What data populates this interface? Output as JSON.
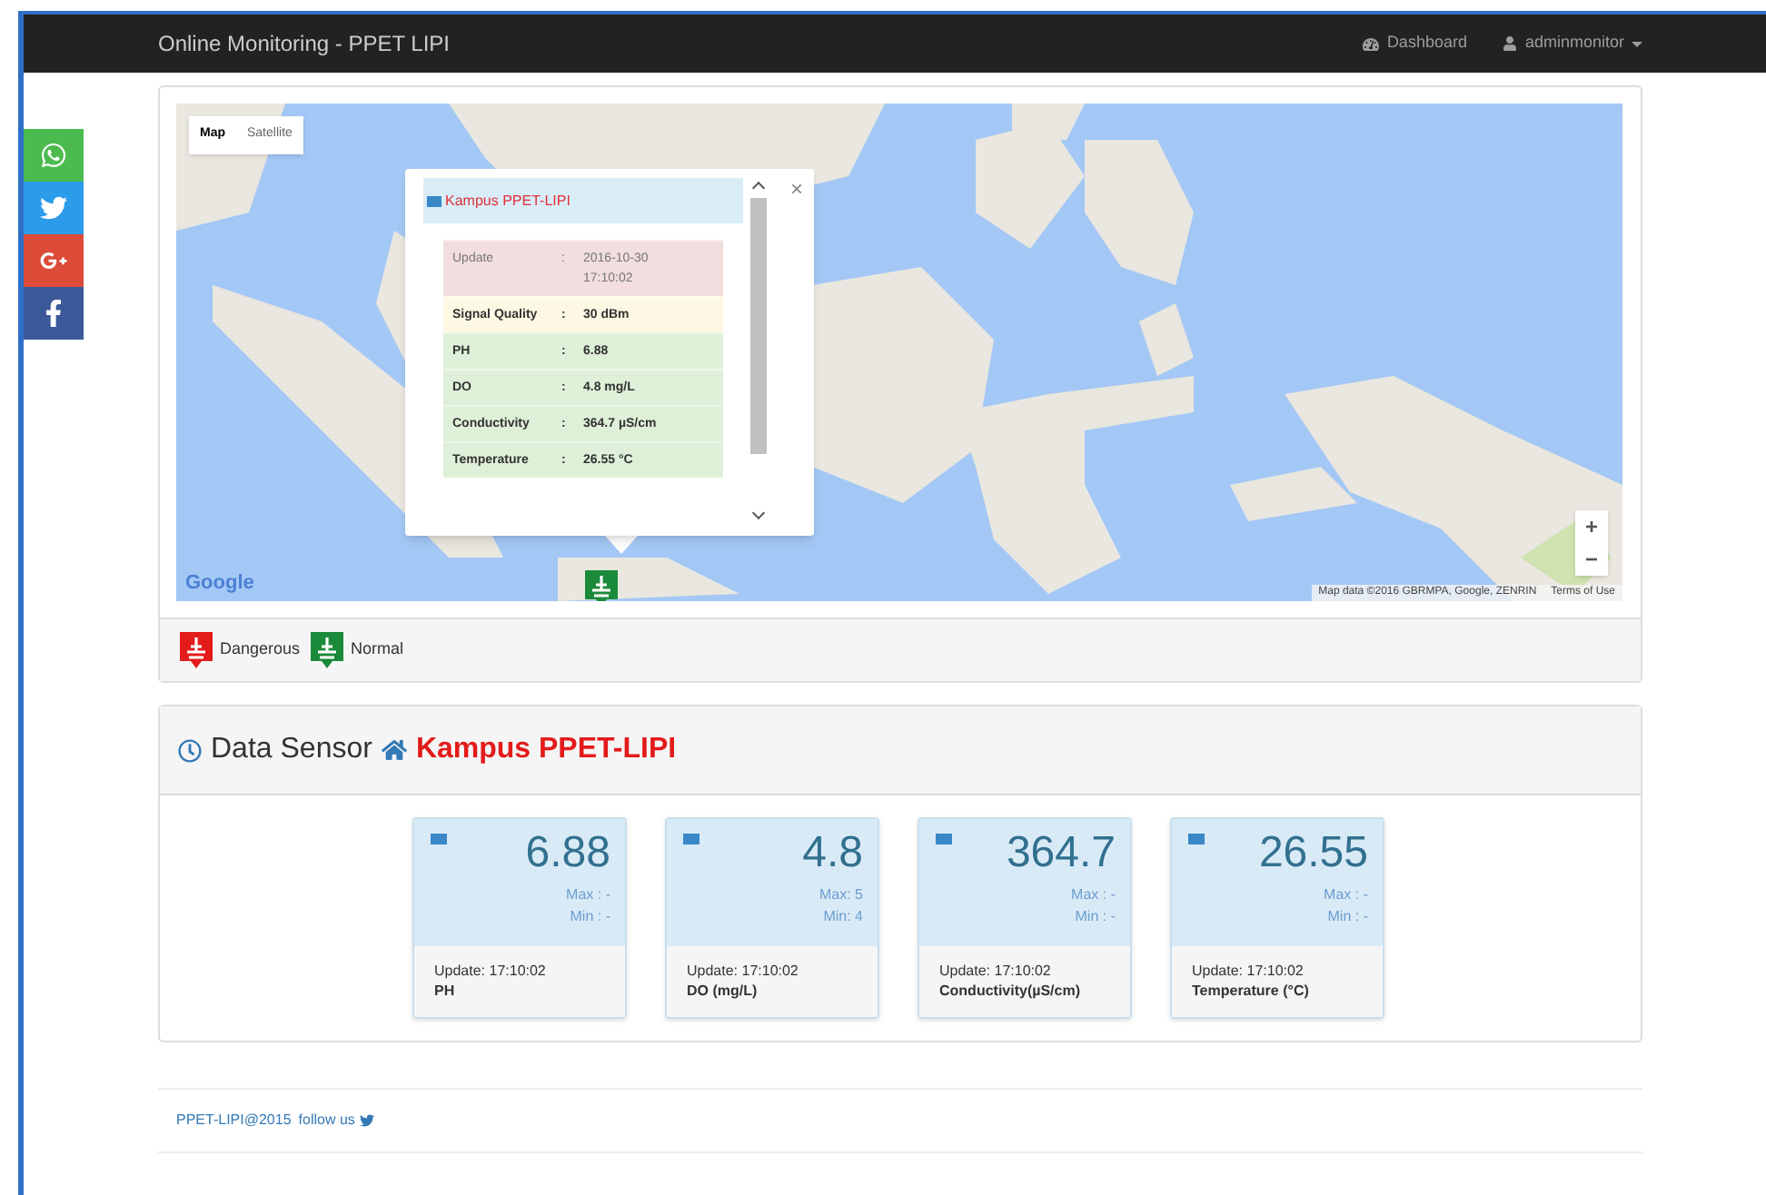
{
  "navbar": {
    "brand": "Online Monitoring - PPET LIPI",
    "links": [
      {
        "kind": "dashboard",
        "label": "Dashboard"
      },
      {
        "kind": "user",
        "label": "adminmonitor"
      }
    ]
  },
  "social": [
    {
      "kind": "whatsapp",
      "color": "#4cbb4f"
    },
    {
      "kind": "twitter",
      "color": "#2b9bea"
    },
    {
      "kind": "googleplus",
      "color": "#dd4b39"
    },
    {
      "kind": "facebook",
      "color": "#3b5998"
    }
  ],
  "map": {
    "types": [
      {
        "label": "Map",
        "selected": true
      },
      {
        "label": "Satellite",
        "selected": false
      }
    ],
    "logo": "Google",
    "attribution": "Map data ©2016 GBRMPA, Google, ZENRIN",
    "terms": "Terms of Use",
    "zoom_in": "+",
    "zoom_out": "−",
    "popup": {
      "title": "Kampus PPET-LIPI",
      "close": "×",
      "rows": [
        {
          "label": "Update",
          "sep": ":",
          "value": "2016-10-30 17:10:02",
          "kind": "danger"
        },
        {
          "label": "Signal Quality",
          "sep": ":",
          "value": "30 dBm",
          "kind": "warning"
        },
        {
          "label": "PH",
          "sep": ":",
          "value": "6.88",
          "kind": "success"
        },
        {
          "label": "DO",
          "sep": ":",
          "value": "4.8 mg/L",
          "kind": "success"
        },
        {
          "label": "Conductivity",
          "sep": ":",
          "value": "364.7 µS/cm",
          "kind": "success"
        },
        {
          "label": "Temperature",
          "sep": ":",
          "value": "26.55 °C",
          "kind": "success"
        }
      ]
    }
  },
  "legend": [
    {
      "label": "Dangerous",
      "color": "#e31b1b"
    },
    {
      "label": "Normal",
      "color": "#1b8a3a"
    }
  ],
  "sensor_panel": {
    "title": "Data Sensor",
    "location": "Kampus PPET-LIPI",
    "cards": [
      {
        "value": "6.88",
        "max": "Max : -",
        "min": "Min : -",
        "update": "Update: 17:10:02",
        "label": "PH"
      },
      {
        "value": "4.8",
        "max": "Max: 5",
        "min": "Min: 4",
        "update": "Update: 17:10:02",
        "label": "DO (mg/L)"
      },
      {
        "value": "364.7",
        "max": "Max : -",
        "min": "Min : -",
        "update": "Update: 17:10:02",
        "label": "Conductivity(µS/cm)"
      },
      {
        "value": "26.55",
        "max": "Max : -",
        "min": "Min : -",
        "update": "Update: 17:10:02",
        "label": "Temperature (°C)"
      }
    ]
  },
  "footer": {
    "text": "PPET-LIPI@2015",
    "follow": "follow us"
  }
}
